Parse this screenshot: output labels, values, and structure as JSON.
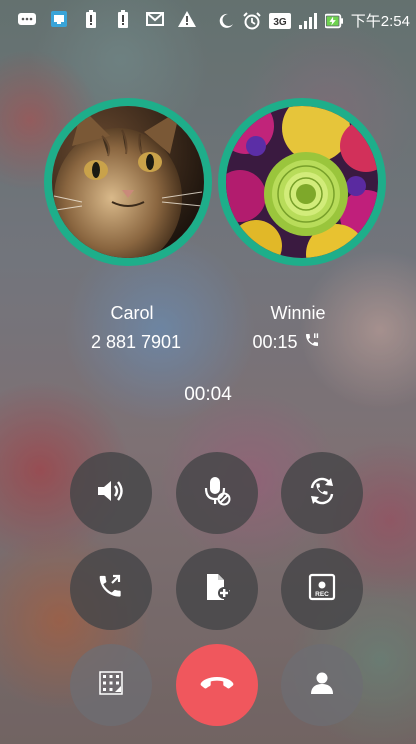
{
  "status_bar": {
    "time": "下午2:54",
    "network": "3G",
    "icons": [
      "chat-icon",
      "app-icon",
      "battery-alert-icon",
      "battery-alert-icon",
      "mail-icon",
      "warning-icon"
    ],
    "right_icons": [
      "moon-icon",
      "alarm-icon",
      "network-3g-icon",
      "signal-icon",
      "battery-charging-icon"
    ]
  },
  "callers": [
    {
      "name": "Carol",
      "number": "2 881 7901",
      "avatar": "cat-photo"
    },
    {
      "name": "Winnie",
      "elapsed": "00:15",
      "status_icon": "on-hold-call-icon",
      "avatar": "flower-photo"
    }
  ],
  "call_duration": "00:04",
  "controls": [
    {
      "name": "speaker",
      "icon": "speaker-icon"
    },
    {
      "name": "mute",
      "icon": "mic-mute-icon"
    },
    {
      "name": "swap",
      "icon": "swap-call-icon"
    },
    {
      "name": "merge",
      "icon": "merge-call-icon"
    },
    {
      "name": "note",
      "icon": "add-note-icon"
    },
    {
      "name": "record",
      "icon": "record-icon",
      "label": "REC"
    },
    {
      "name": "keypad",
      "icon": "keypad-icon"
    },
    {
      "name": "end-call",
      "icon": "end-call-icon",
      "color": "#f0575d"
    },
    {
      "name": "contacts",
      "icon": "contact-icon"
    }
  ],
  "accent_color": "#1eae8a"
}
